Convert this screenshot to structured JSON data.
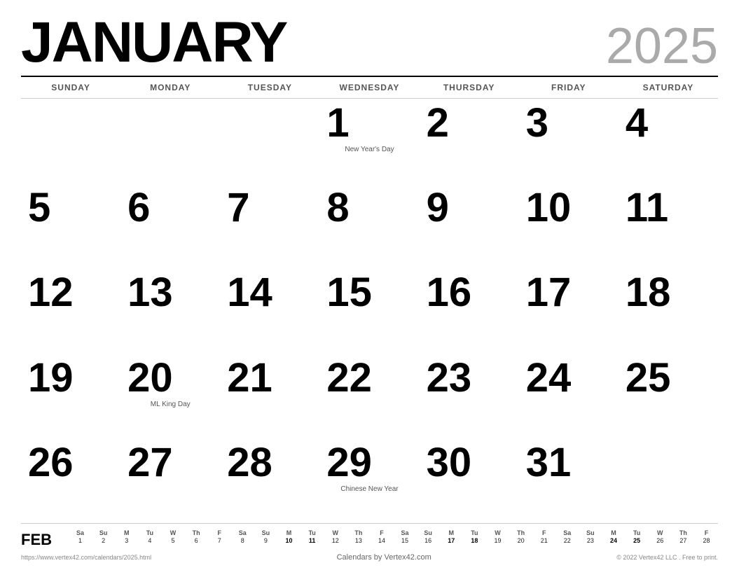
{
  "header": {
    "month": "JANUARY",
    "year": "2025"
  },
  "days_of_week": [
    "SUNDAY",
    "MONDAY",
    "TUESDAY",
    "WEDNESDAY",
    "THURSDAY",
    "FRIDAY",
    "SATURDAY"
  ],
  "weeks": [
    [
      {
        "day": "",
        "empty": true
      },
      {
        "day": "",
        "empty": true
      },
      {
        "day": "",
        "empty": true
      },
      {
        "day": "1",
        "holiday": "New Year's Day"
      },
      {
        "day": "2",
        "holiday": ""
      },
      {
        "day": "3",
        "holiday": ""
      },
      {
        "day": "4",
        "holiday": ""
      }
    ],
    [
      {
        "day": "5",
        "holiday": ""
      },
      {
        "day": "6",
        "holiday": ""
      },
      {
        "day": "7",
        "holiday": ""
      },
      {
        "day": "8",
        "holiday": ""
      },
      {
        "day": "9",
        "holiday": ""
      },
      {
        "day": "10",
        "holiday": ""
      },
      {
        "day": "11",
        "holiday": ""
      }
    ],
    [
      {
        "day": "12",
        "holiday": ""
      },
      {
        "day": "13",
        "holiday": ""
      },
      {
        "day": "14",
        "holiday": ""
      },
      {
        "day": "15",
        "holiday": ""
      },
      {
        "day": "16",
        "holiday": ""
      },
      {
        "day": "17",
        "holiday": ""
      },
      {
        "day": "18",
        "holiday": ""
      }
    ],
    [
      {
        "day": "19",
        "holiday": ""
      },
      {
        "day": "20",
        "holiday": "ML King Day"
      },
      {
        "day": "21",
        "holiday": ""
      },
      {
        "day": "22",
        "holiday": ""
      },
      {
        "day": "23",
        "holiday": ""
      },
      {
        "day": "24",
        "holiday": ""
      },
      {
        "day": "25",
        "holiday": ""
      }
    ],
    [
      {
        "day": "26",
        "holiday": ""
      },
      {
        "day": "27",
        "holiday": ""
      },
      {
        "day": "28",
        "holiday": ""
      },
      {
        "day": "29",
        "holiday": "Chinese New Year"
      },
      {
        "day": "30",
        "holiday": ""
      },
      {
        "day": "31",
        "holiday": ""
      },
      {
        "day": "",
        "empty": true
      }
    ]
  ],
  "mini_calendar": {
    "label": "FEB",
    "dow": [
      "Sa",
      "Su",
      "M",
      "Tu",
      "W",
      "Th",
      "F",
      "Sa",
      "Su",
      "M",
      "Tu",
      "W",
      "Th",
      "F",
      "Sa",
      "Su",
      "M",
      "Tu",
      "W",
      "Th",
      "F",
      "Sa",
      "Su",
      "M",
      "Tu",
      "W",
      "Th",
      "F"
    ],
    "days": [
      "1",
      "2",
      "3",
      "4",
      "5",
      "6",
      "7",
      "8",
      "9",
      "10",
      "11",
      "12",
      "13",
      "14",
      "15",
      "16",
      "17",
      "18",
      "19",
      "20",
      "21",
      "22",
      "23",
      "24",
      "25",
      "26",
      "27",
      "28"
    ],
    "bold_days": [
      "10",
      "11",
      "17",
      "18",
      "24",
      "25"
    ]
  },
  "footer": {
    "url": "https://www.vertex42.com/calendars/2025.html",
    "center": "Calendars by Vertex42.com",
    "copyright": "© 2022 Vertex42 LLC . Free to print."
  }
}
